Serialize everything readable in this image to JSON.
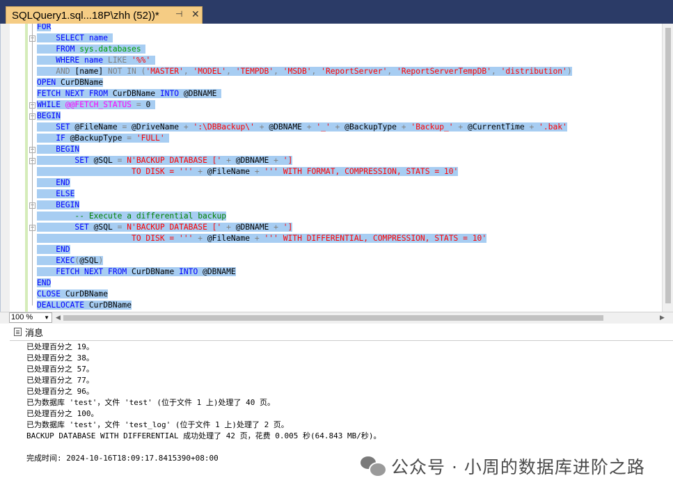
{
  "tab": {
    "title": "SQLQuery1.sql...18P\\zhh (52))*",
    "pin_icon": "pin-icon",
    "close_icon": "close-icon"
  },
  "editor": {
    "lines": [
      {
        "tokens": [
          {
            "t": "FOR",
            "c": "kw"
          }
        ]
      },
      {
        "tokens": [
          {
            "t": "    SELECT ",
            "c": "kw"
          },
          {
            "t": "name",
            "c": "kw"
          },
          {
            "t": " ",
            "c": "id"
          }
        ]
      },
      {
        "tokens": [
          {
            "t": "    FROM ",
            "c": "kw"
          },
          {
            "t": "sys.databases",
            "c": "sys"
          },
          {
            "t": " ",
            "c": "id"
          }
        ]
      },
      {
        "tokens": [
          {
            "t": "    WHERE ",
            "c": "kw"
          },
          {
            "t": "name ",
            "c": "kw"
          },
          {
            "t": "LIKE ",
            "c": "gray"
          },
          {
            "t": "'%%'",
            "c": "str"
          },
          {
            "t": " ",
            "c": "id"
          }
        ]
      },
      {
        "tokens": [
          {
            "t": "    AND ",
            "c": "gray"
          },
          {
            "t": "[name] ",
            "c": "id"
          },
          {
            "t": "NOT IN ",
            "c": "gray"
          },
          {
            "t": "(",
            "c": "gray"
          },
          {
            "t": "'MASTER'",
            "c": "str"
          },
          {
            "t": ", ",
            "c": "gray"
          },
          {
            "t": "'MODEL'",
            "c": "str"
          },
          {
            "t": ", ",
            "c": "gray"
          },
          {
            "t": "'TEMPDB'",
            "c": "str"
          },
          {
            "t": ", ",
            "c": "gray"
          },
          {
            "t": "'MSDB'",
            "c": "str"
          },
          {
            "t": ", ",
            "c": "gray"
          },
          {
            "t": "'ReportServer'",
            "c": "str"
          },
          {
            "t": ", ",
            "c": "gray"
          },
          {
            "t": "'ReportServerTempDB'",
            "c": "str"
          },
          {
            "t": ", ",
            "c": "gray"
          },
          {
            "t": "'distribution'",
            "c": "str"
          },
          {
            "t": ")",
            "c": "gray"
          }
        ]
      },
      {
        "tokens": [
          {
            "t": "OPEN ",
            "c": "kw"
          },
          {
            "t": "CurDBName",
            "c": "id"
          }
        ]
      },
      {
        "tokens": [
          {
            "t": "FETCH NEXT FROM ",
            "c": "kw"
          },
          {
            "t": "CurDBName ",
            "c": "id"
          },
          {
            "t": "INTO ",
            "c": "kw"
          },
          {
            "t": "@DBNAME ",
            "c": "id"
          }
        ]
      },
      {
        "tokens": [
          {
            "t": "WHILE ",
            "c": "kw"
          },
          {
            "t": "@@FETCH_STATUS ",
            "c": "fn"
          },
          {
            "t": "= ",
            "c": "gray"
          },
          {
            "t": "0 ",
            "c": "id"
          }
        ]
      },
      {
        "tokens": [
          {
            "t": "BEGIN",
            "c": "kw"
          }
        ]
      },
      {
        "tokens": [
          {
            "t": "    SET ",
            "c": "kw"
          },
          {
            "t": "@FileName ",
            "c": "id"
          },
          {
            "t": "= ",
            "c": "gray"
          },
          {
            "t": "@DriveName ",
            "c": "id"
          },
          {
            "t": "+ ",
            "c": "gray"
          },
          {
            "t": "':\\DBBackup\\'",
            "c": "str"
          },
          {
            "t": " + ",
            "c": "gray"
          },
          {
            "t": "@DBNAME ",
            "c": "id"
          },
          {
            "t": "+ ",
            "c": "gray"
          },
          {
            "t": "'_'",
            "c": "str"
          },
          {
            "t": " + ",
            "c": "gray"
          },
          {
            "t": "@BackupType ",
            "c": "id"
          },
          {
            "t": "+ ",
            "c": "gray"
          },
          {
            "t": "'Backup_'",
            "c": "str"
          },
          {
            "t": " + ",
            "c": "gray"
          },
          {
            "t": "@CurrentTime ",
            "c": "id"
          },
          {
            "t": "+ ",
            "c": "gray"
          },
          {
            "t": "'.bak'",
            "c": "str"
          }
        ]
      },
      {
        "tokens": [
          {
            "t": "    IF ",
            "c": "kw"
          },
          {
            "t": "@BackupType ",
            "c": "id"
          },
          {
            "t": "= ",
            "c": "gray"
          },
          {
            "t": "'FULL'",
            "c": "str"
          },
          {
            "t": " ",
            "c": "id"
          }
        ]
      },
      {
        "tokens": [
          {
            "t": "    BEGIN",
            "c": "kw"
          }
        ]
      },
      {
        "tokens": [
          {
            "t": "        SET ",
            "c": "kw"
          },
          {
            "t": "@SQL ",
            "c": "id"
          },
          {
            "t": "= ",
            "c": "gray"
          },
          {
            "t": "N'BACKUP DATABASE ['",
            "c": "str"
          },
          {
            "t": " + ",
            "c": "gray"
          },
          {
            "t": "@DBNAME ",
            "c": "id"
          },
          {
            "t": "+ ",
            "c": "gray"
          },
          {
            "t": "']",
            "c": "str"
          }
        ]
      },
      {
        "tokens": [
          {
            "t": "                    TO DISK = '''",
            "c": "str"
          },
          {
            "t": " + ",
            "c": "gray"
          },
          {
            "t": "@FileName ",
            "c": "id"
          },
          {
            "t": "+ ",
            "c": "gray"
          },
          {
            "t": "''' WITH FORMAT, COMPRESSION, STATS = 10'",
            "c": "str"
          }
        ]
      },
      {
        "tokens": [
          {
            "t": "    END",
            "c": "kw"
          }
        ]
      },
      {
        "tokens": [
          {
            "t": "    ELSE",
            "c": "kw"
          }
        ]
      },
      {
        "tokens": [
          {
            "t": "    BEGIN",
            "c": "kw"
          }
        ]
      },
      {
        "tokens": [
          {
            "t": "        -- Execute a differential backup",
            "c": "cm"
          }
        ]
      },
      {
        "tokens": [
          {
            "t": "        SET ",
            "c": "kw"
          },
          {
            "t": "@SQL ",
            "c": "id"
          },
          {
            "t": "= ",
            "c": "gray"
          },
          {
            "t": "N'BACKUP DATABASE ['",
            "c": "str"
          },
          {
            "t": " + ",
            "c": "gray"
          },
          {
            "t": "@DBNAME ",
            "c": "id"
          },
          {
            "t": "+ ",
            "c": "gray"
          },
          {
            "t": "']",
            "c": "str"
          }
        ]
      },
      {
        "tokens": [
          {
            "t": "                    TO DISK = '''",
            "c": "str"
          },
          {
            "t": " + ",
            "c": "gray"
          },
          {
            "t": "@FileName ",
            "c": "id"
          },
          {
            "t": "+ ",
            "c": "gray"
          },
          {
            "t": "''' WITH DIFFERENTIAL, COMPRESSION, STATS = 10'",
            "c": "str"
          }
        ]
      },
      {
        "tokens": [
          {
            "t": "    END",
            "c": "kw"
          }
        ]
      },
      {
        "tokens": [
          {
            "t": "    EXEC",
            "c": "kw"
          },
          {
            "t": "(",
            "c": "gray"
          },
          {
            "t": "@SQL",
            "c": "id"
          },
          {
            "t": ")",
            "c": "gray"
          }
        ]
      },
      {
        "tokens": [
          {
            "t": "    FETCH NEXT FROM ",
            "c": "kw"
          },
          {
            "t": "CurDBName ",
            "c": "id"
          },
          {
            "t": "INTO ",
            "c": "kw"
          },
          {
            "t": "@DBNAME",
            "c": "id"
          }
        ]
      },
      {
        "tokens": [
          {
            "t": "END",
            "c": "kw"
          }
        ]
      },
      {
        "tokens": [
          {
            "t": "CLOSE ",
            "c": "kw"
          },
          {
            "t": "CurDBName",
            "c": "id"
          }
        ]
      },
      {
        "tokens": [
          {
            "t": "DEALLOCATE ",
            "c": "kw"
          },
          {
            "t": "CurDBName",
            "c": "id"
          }
        ]
      }
    ]
  },
  "zoom": {
    "value": "100 %"
  },
  "results": {
    "tab_label": "消息",
    "tab_icon": "messages-icon",
    "lines": [
      "已处理百分之 19。",
      "已处理百分之 38。",
      "已处理百分之 57。",
      "已处理百分之 77。",
      "已处理百分之 96。",
      "已为数据库 'test'，文件 'test' (位于文件 1 上)处理了 40 页。",
      "已处理百分之 100。",
      "已为数据库 'test'，文件 'test_log' (位于文件 1 上)处理了 2 页。",
      "BACKUP DATABASE WITH DIFFERENTIAL 成功处理了 42 页，花费 0.005 秒(64.843 MB/秒)。",
      "",
      "完成时间: 2024-10-16T18:09:17.8415390+08:00"
    ]
  },
  "watermark": {
    "text": "公众号 · 小周的数据库进阶之路"
  }
}
